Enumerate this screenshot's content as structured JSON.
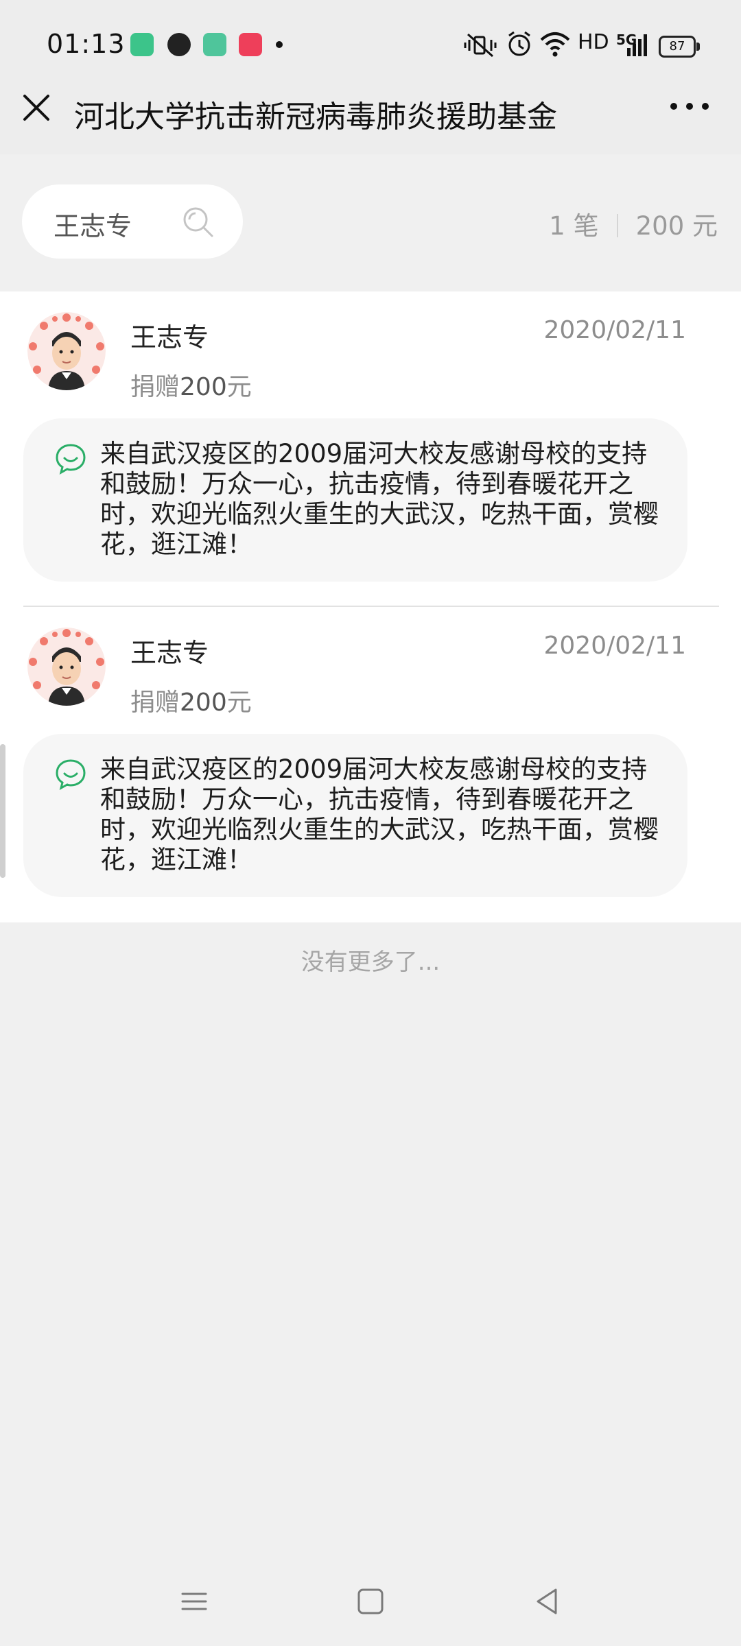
{
  "status_bar": {
    "time": "01:13",
    "network": "HD",
    "signal": "5G",
    "battery": "87"
  },
  "header": {
    "title": "河北大学抗击新冠病毒肺炎援助基金"
  },
  "search": {
    "value": "王志专"
  },
  "summary": {
    "count": "1 笔",
    "total": "200 元"
  },
  "donations": [
    {
      "name": "王志专",
      "date": "2020/02/11",
      "amount_prefix": "捐赠",
      "amount_value": "200",
      "amount_unit": "元",
      "message": "来自武汉疫区的2009届河大校友感谢母校的支持和鼓励！万众一心，抗击疫情，待到春暖花开之时，欢迎光临烈火重生的大武汉，吃热干面，赏樱花，逛江滩！"
    },
    {
      "name": "王志专",
      "date": "2020/02/11",
      "amount_prefix": "捐赠",
      "amount_value": "200",
      "amount_unit": "元",
      "message": "来自武汉疫区的2009届河大校友感谢母校的支持和鼓励！万众一心，抗击疫情，待到春暖花开之时，欢迎光临烈火重生的大武汉，吃热干面，赏樱花，逛江滩！"
    }
  ],
  "footer": {
    "no_more": "没有更多了..."
  },
  "colors": {
    "accent_green": "#2aae67",
    "page_bg": "#f0f0f0",
    "muted_text": "#8d8d8d"
  },
  "icons": [
    "close-icon",
    "more-icon",
    "search-icon",
    "message-smile-icon",
    "menu-icon",
    "home-icon",
    "back-icon"
  ]
}
